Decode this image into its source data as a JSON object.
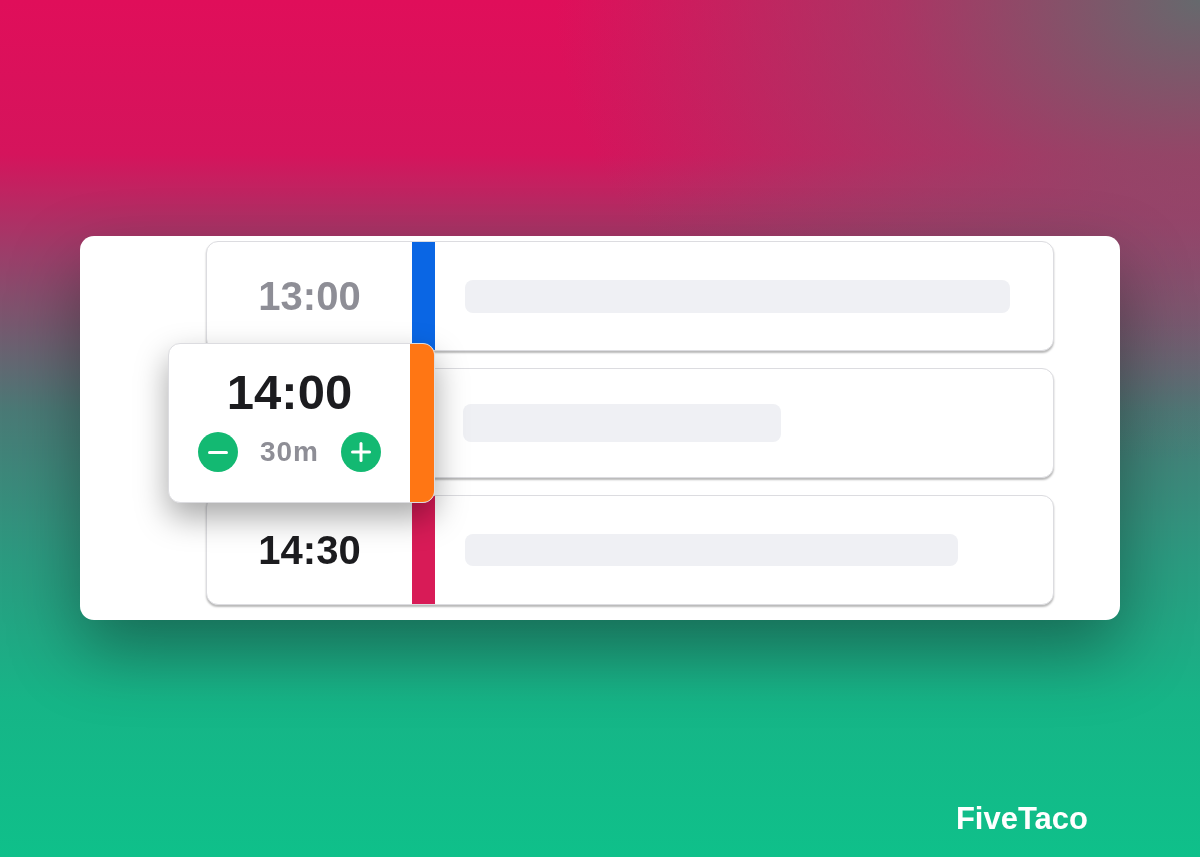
{
  "rows": [
    {
      "time": "13:00",
      "color": "#0a66e4",
      "dimmed": true,
      "selected": false
    },
    {
      "time": "14:00",
      "duration": "30m",
      "color": "#ff7614",
      "dimmed": false,
      "selected": true
    },
    {
      "time": "14:30",
      "color": "#d81b57",
      "dimmed": false,
      "selected": false
    }
  ],
  "brand": {
    "name": "FiveTaco"
  }
}
